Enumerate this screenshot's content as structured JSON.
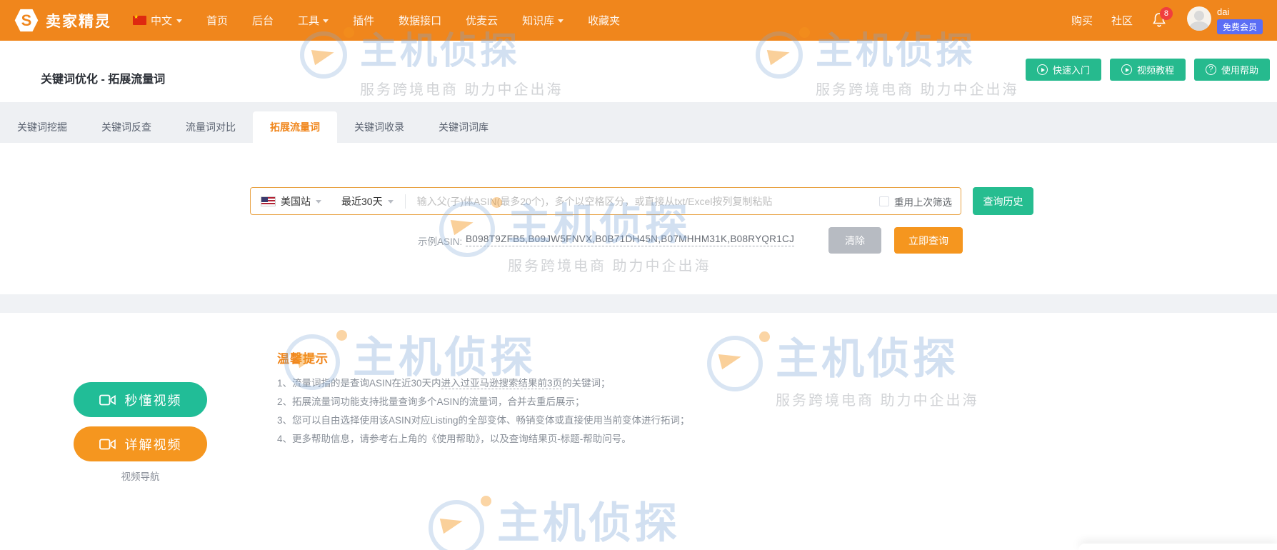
{
  "header": {
    "brand": "卖家精灵",
    "logo_letter": "S",
    "lang": "中文",
    "nav": [
      {
        "label": "首页"
      },
      {
        "label": "后台"
      },
      {
        "label": "工具"
      },
      {
        "label": "插件"
      },
      {
        "label": "数据接口"
      },
      {
        "label": "优麦云"
      },
      {
        "label": "知识库"
      },
      {
        "label": "收藏夹"
      }
    ],
    "right": {
      "buy": "购买",
      "community": "社区",
      "notification_count": "8",
      "username": "dai",
      "membership": "免费会员"
    }
  },
  "page": {
    "title": "关键词优化 - 拓展流量词",
    "help_buttons": {
      "quick_start": "快速入门",
      "video_tutorial": "视频教程",
      "help": "使用帮助"
    }
  },
  "tabs": {
    "items": [
      {
        "label": "关键词挖掘"
      },
      {
        "label": "关键词反查"
      },
      {
        "label": "流量词对比"
      },
      {
        "label": "拓展流量词"
      },
      {
        "label": "关键词收录"
      },
      {
        "label": "关键词词库"
      }
    ],
    "active": "拓展流量词"
  },
  "search": {
    "marketplace": "美国站",
    "date_range": "最近30天",
    "placeholder": "输入父(子)体ASIN(最多20个)，多个以空格区分，或直接从txt/Excel按列复制粘贴",
    "reuse_filter_label": "重用上次筛选",
    "history_button": "查询历史",
    "example_label": "示例ASIN:",
    "example_value": "B098T9ZFB5,B09JW5FNVX,B0B71DH45N,B07MHHM31K,B08RYQR1CJ",
    "clear_button": "清除",
    "query_button": "立即查询"
  },
  "video_nav": {
    "quick_video": "秒懂视频",
    "detail_video": "详解视频",
    "caption": "视频导航"
  },
  "tips": {
    "title": "温馨提示",
    "line1_prefix": "1、流量词指的是查询ASIN在近30天内",
    "line1_underline": "进入过亚马逊搜索结果前3页",
    "line1_suffix": "的关键词；",
    "line2": "2、拓展流量词功能支持批量查询多个ASIN的流量词，合并去重后展示；",
    "line3": "3、您可以自由选择使用该ASIN对应Listing的全部变体、畅销变体或直接使用当前变体进行拓词；",
    "line4": "4、更多帮助信息，请参考右上角的《使用帮助》，以及查询结果页-标题-帮助问号。"
  },
  "watermark": {
    "text": "主机侦探",
    "subtitle": "服务跨境电商  助力中企出海"
  },
  "colors": {
    "primary_orange": "#f0861c",
    "button_orange": "#f5961f",
    "green": "#26ba8e",
    "pill_green": "#21bd97",
    "membership_badge_blue": "#5b6ef5",
    "gray_button": "#b7bbc2",
    "notification_red": "#f03e3e"
  }
}
